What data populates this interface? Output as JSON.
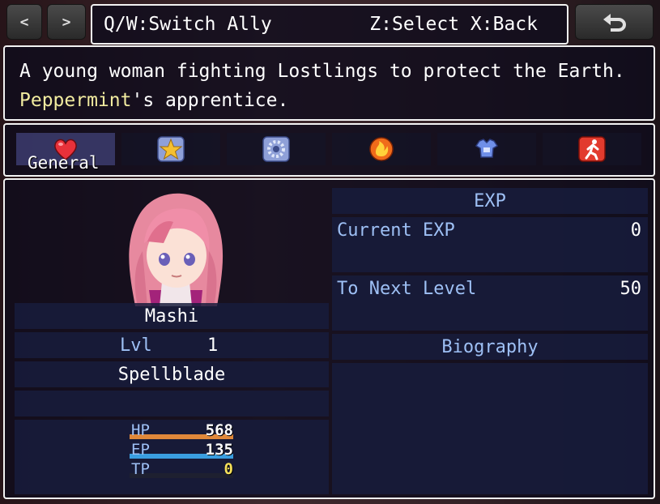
{
  "header": {
    "prev_label": "<",
    "next_label": ">",
    "switch_hint": "Q/W:Switch Ally",
    "select_hint": "Z:Select X:Back",
    "back_icon": "return-arrow-icon"
  },
  "description": {
    "line1": "A young woman fighting Lostlings to protect the Earth.",
    "line2_highlight": "Peppermint",
    "line2_rest": "'s apprentice."
  },
  "tabs": [
    {
      "label": "General",
      "icon": "heart-icon",
      "active": true
    },
    {
      "label": "",
      "icon": "star-icon",
      "active": false
    },
    {
      "label": "",
      "icon": "gear-icon",
      "active": false
    },
    {
      "label": "",
      "icon": "fire-icon",
      "active": false
    },
    {
      "label": "",
      "icon": "armor-icon",
      "active": false
    },
    {
      "label": "",
      "icon": "running-man-icon",
      "active": false
    }
  ],
  "actor": {
    "name": "Mashi",
    "level_label": "Lvl",
    "level": "1",
    "class": "Spellblade",
    "hp_label": "HP",
    "hp": "568",
    "ep_label": "EP",
    "ep": "135",
    "tp_label": "TP",
    "tp": "0",
    "hp_ratio": 1.0,
    "ep_ratio": 1.0,
    "tp_ratio": 0.0
  },
  "exp": {
    "title": "EXP",
    "current_label": "Current EXP",
    "current_value": "0",
    "next_label": "To Next Level",
    "next_value": "50"
  },
  "biography": {
    "title": "Biography"
  },
  "colors": {
    "hp_bar": "#e0883a",
    "ep_bar": "#3a9ee0",
    "tp_value": "#f5e05a",
    "highlight": "#f2eca0"
  }
}
